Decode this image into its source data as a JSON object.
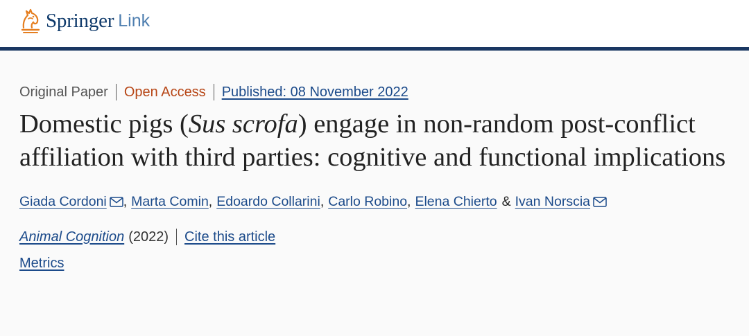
{
  "brand": {
    "name_part1": "Springer",
    "name_part2": "Link"
  },
  "article": {
    "type": "Original Paper",
    "access": "Open Access",
    "published": "Published: 08 November 2022",
    "title_part1": "Domestic pigs (",
    "title_italic": "Sus scrofa",
    "title_part2": ") engage in non-random post-conflict affiliation with third parties: cognitive and functional implications"
  },
  "authors": [
    {
      "name": "Giada Cordoni",
      "mail_icon": "envelope-icon"
    },
    {
      "name": "Marta Comin"
    },
    {
      "name": "Edoardo Collarini"
    },
    {
      "name": "Carlo Robino"
    },
    {
      "name": "Elena Chierto"
    },
    {
      "name": "Ivan Norscia",
      "mail_icon": "envelope-icon"
    }
  ],
  "separators": {
    "comma": ",",
    "ampersand": "&"
  },
  "journal": {
    "name": "Animal Cognition",
    "year": "(2022)",
    "cite_link": "Cite this article"
  },
  "metrics_link": "Metrics",
  "colors": {
    "header_rule": "#1a3762",
    "link": "#1b4a8a",
    "open_access": "#b74616",
    "background": "#fafafa"
  }
}
